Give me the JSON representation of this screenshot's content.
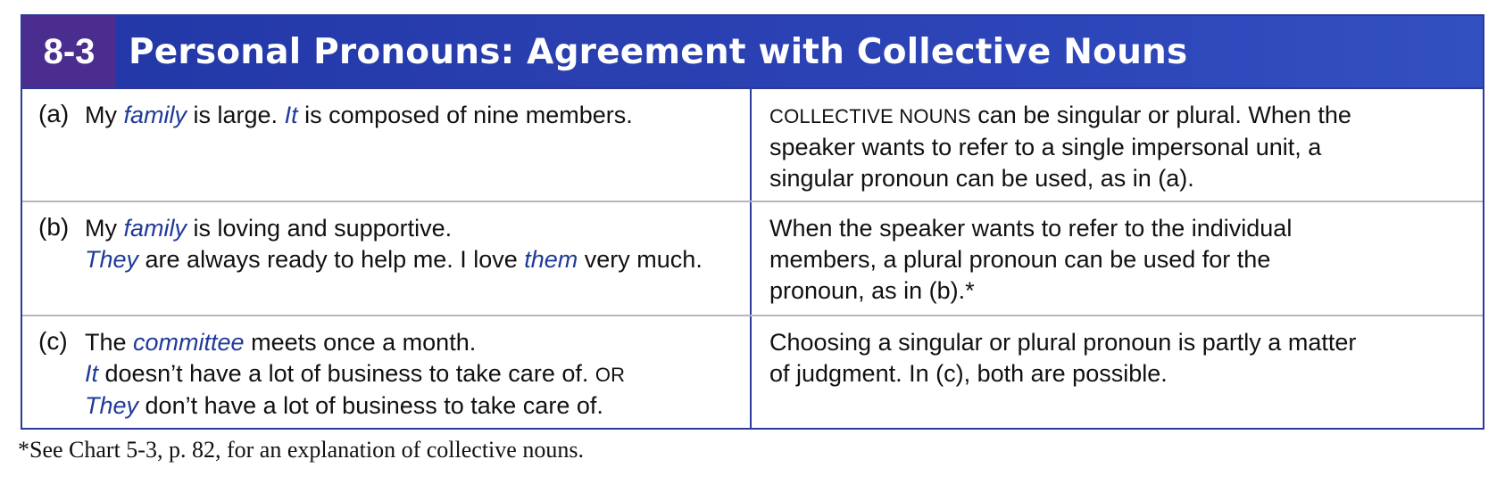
{
  "chart": {
    "number": "8-3",
    "title": "Personal Pronouns:  Agreement with Collective Nouns",
    "colors": {
      "header_bg": "#2a3fb0",
      "number_bg": "#4a2d8f",
      "emphasis": "#1f3a99"
    }
  },
  "rows": [
    {
      "label": "(a)",
      "example": {
        "l1": {
          "t1": "My ",
          "e1": "family",
          "t2": " is large.  ",
          "e2": "It",
          "t3": " is composed of nine members."
        }
      },
      "note": {
        "sc": "COLLECTIVE NOUNS",
        "l1_rest": " can be singular or plural.  When the",
        "l2": "speaker wants to refer to a single impersonal unit, a",
        "l3": "singular pronoun can be used, as in (a)."
      }
    },
    {
      "label": "(b)",
      "example": {
        "l1": {
          "t1": "My ",
          "e1": "family",
          "t2": " is loving and supportive."
        },
        "l2": {
          "e1": "They",
          "t1": " are always ready to help me.  I love ",
          "e2": "them",
          "t2": " very much."
        }
      },
      "note": {
        "l1": "When the speaker wants to refer to the individual",
        "l2": "members, a plural pronoun can be used for the",
        "l3": "pronoun, as in (b).*"
      }
    },
    {
      "label": "(c)",
      "example": {
        "l1": {
          "t1": "The ",
          "e1": "committee",
          "t2": " meets once a month."
        },
        "l2": {
          "e1": "It",
          "t1": " doesn’t have a lot of business to take care of.  ",
          "or": "OR"
        },
        "l3": {
          "e1": "They",
          "t1": " don’t have a lot of business to take care of."
        }
      },
      "note": {
        "l1": "Choosing a singular or plural pronoun is partly a matter",
        "l2": "of judgment.  In (c), both are possible."
      }
    }
  ],
  "footnote": "*See Chart 5-3, p. 82, for an explanation of collective nouns."
}
